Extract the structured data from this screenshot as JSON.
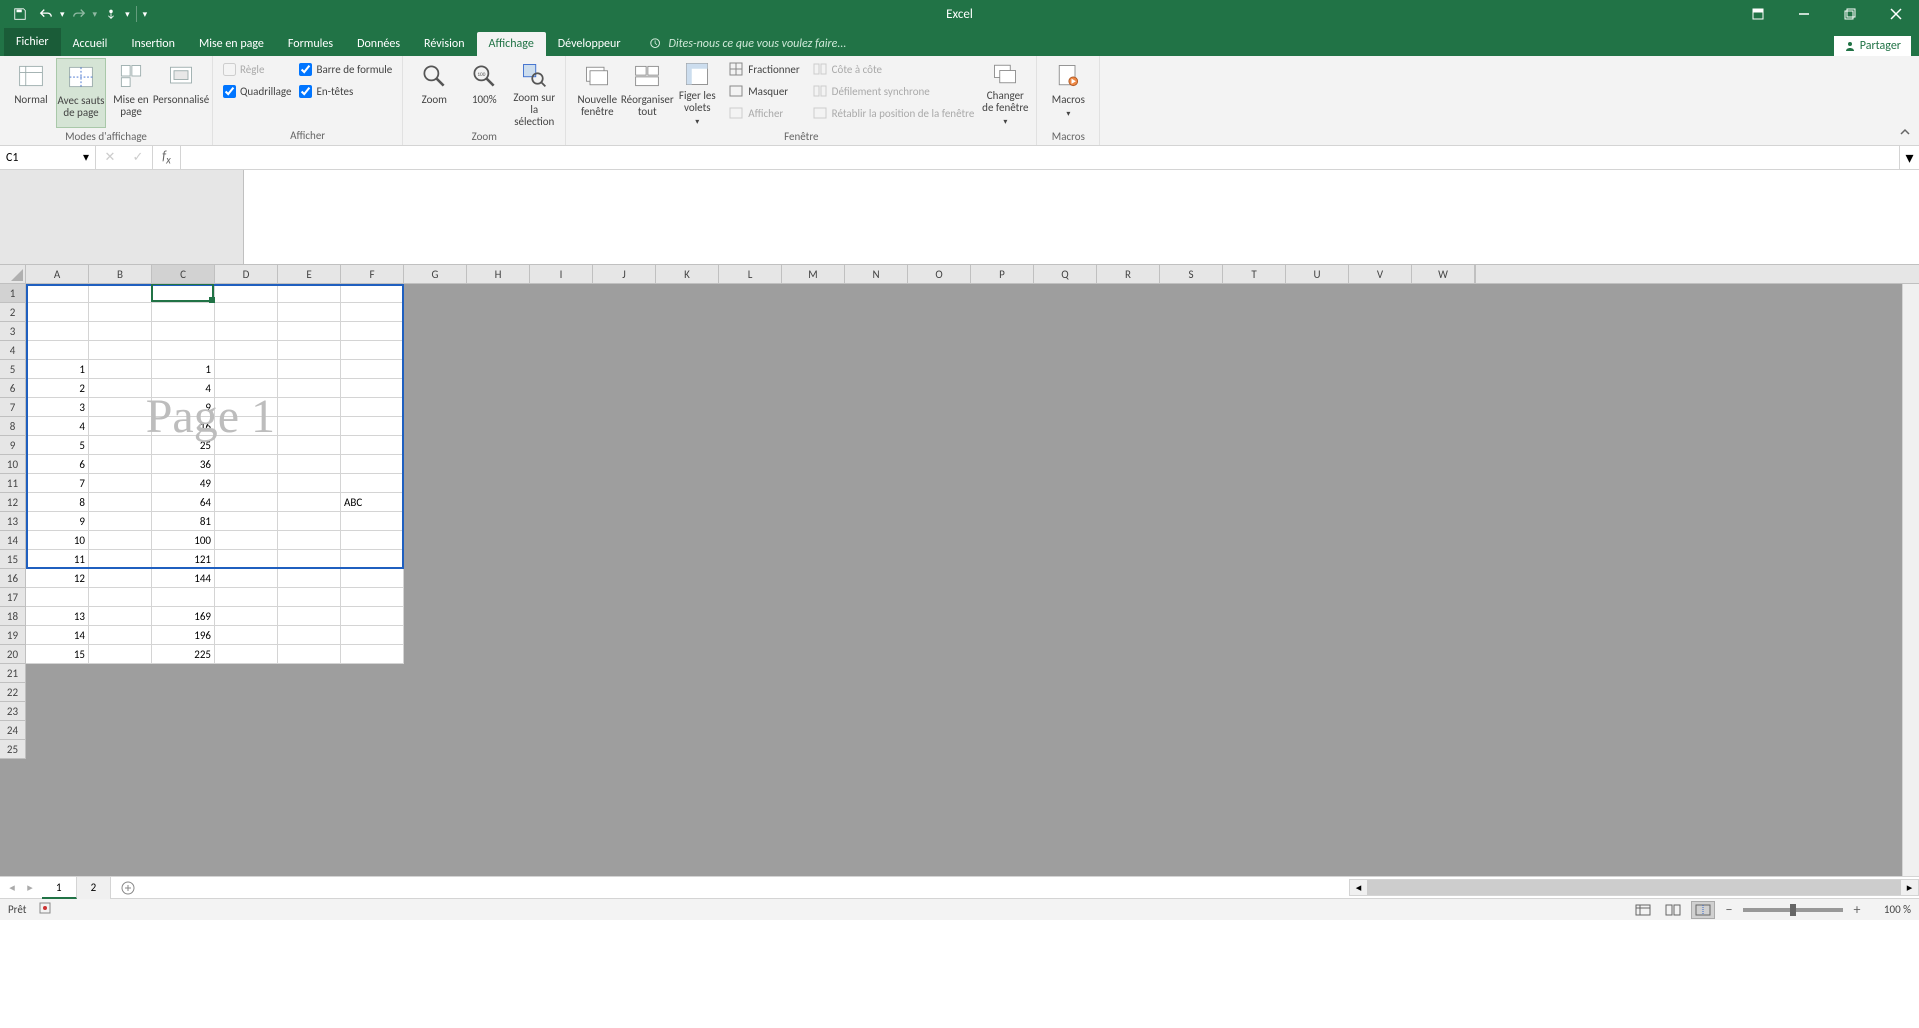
{
  "app_title": "Excel",
  "qat": {
    "save": "Enregistrer",
    "undo": "Annuler",
    "redo": "Rétablir"
  },
  "tabs": {
    "file": "Fichier",
    "items": [
      "Accueil",
      "Insertion",
      "Mise en page",
      "Formules",
      "Données",
      "Révision",
      "Affichage",
      "Développeur"
    ],
    "active_index": 6,
    "tellme": "Dites-nous ce que vous voulez faire..."
  },
  "share_label": "Partager",
  "ribbon": {
    "modes": {
      "label": "Modes d'affichage",
      "normal": "Normal",
      "page_break": "Avec sauts de page",
      "page_layout": "Mise en page",
      "custom": "Personnalisé"
    },
    "show": {
      "label": "Afficher",
      "ruler": "Règle",
      "formula_bar": "Barre de formule",
      "gridlines": "Quadrillage",
      "headings": "En-têtes"
    },
    "zoom": {
      "label": "Zoom",
      "zoom": "Zoom",
      "hundred": "100%",
      "selection": "Zoom sur la sélection"
    },
    "window": {
      "label": "Fenêtre",
      "new_window": "Nouvelle fenêtre",
      "arrange": "Réorganiser tout",
      "freeze": "Figer les volets",
      "split": "Fractionner",
      "hide": "Masquer",
      "unhide": "Afficher",
      "side_by_side": "Côte à côte",
      "sync_scroll": "Défilement synchrone",
      "reset_pos": "Rétablir la position de la fenêtre",
      "switch": "Changer de fenêtre"
    },
    "macros": {
      "label": "Macros",
      "macros": "Macros"
    }
  },
  "name_box": "C1",
  "formula": "",
  "columns": [
    "A",
    "B",
    "C",
    "D",
    "E",
    "F",
    "G",
    "H",
    "I",
    "J",
    "K",
    "L",
    "M",
    "N",
    "O",
    "P",
    "Q",
    "R",
    "S",
    "T",
    "U",
    "V",
    "W"
  ],
  "selected_col_index": 2,
  "selected_row_index": 0,
  "active_cell": {
    "col": 2,
    "row": 0
  },
  "page_break": {
    "rows": 15,
    "cols": 6
  },
  "page_watermark": "Page 1",
  "rows": [
    {
      "n": 1,
      "A": "",
      "C": ""
    },
    {
      "n": 2,
      "A": "",
      "C": ""
    },
    {
      "n": 3,
      "A": "",
      "C": ""
    },
    {
      "n": 4,
      "A": "",
      "C": ""
    },
    {
      "n": 5,
      "A": "1",
      "C": "1"
    },
    {
      "n": 6,
      "A": "2",
      "C": "4"
    },
    {
      "n": 7,
      "A": "3",
      "C": "9"
    },
    {
      "n": 8,
      "A": "4",
      "C": "16"
    },
    {
      "n": 9,
      "A": "5",
      "C": "25"
    },
    {
      "n": 10,
      "A": "6",
      "C": "36"
    },
    {
      "n": 11,
      "A": "7",
      "C": "49"
    },
    {
      "n": 12,
      "A": "8",
      "C": "64",
      "F": "ABC"
    },
    {
      "n": 13,
      "A": "9",
      "C": "81"
    },
    {
      "n": 14,
      "A": "10",
      "C": "100"
    },
    {
      "n": 15,
      "A": "11",
      "C": "121"
    },
    {
      "n": 16,
      "A": "12",
      "C": "144"
    },
    {
      "n": 17,
      "A": "",
      "C": ""
    },
    {
      "n": 18,
      "A": "13",
      "C": "169"
    },
    {
      "n": 19,
      "A": "14",
      "C": "196"
    },
    {
      "n": 20,
      "A": "15",
      "C": "225"
    },
    {
      "n": 21
    },
    {
      "n": 22
    },
    {
      "n": 23
    },
    {
      "n": 24
    },
    {
      "n": 25
    }
  ],
  "sheets": {
    "items": [
      "1",
      "2"
    ],
    "active_index": 0
  },
  "status": {
    "ready": "Prêt",
    "zoom": "100 %"
  }
}
